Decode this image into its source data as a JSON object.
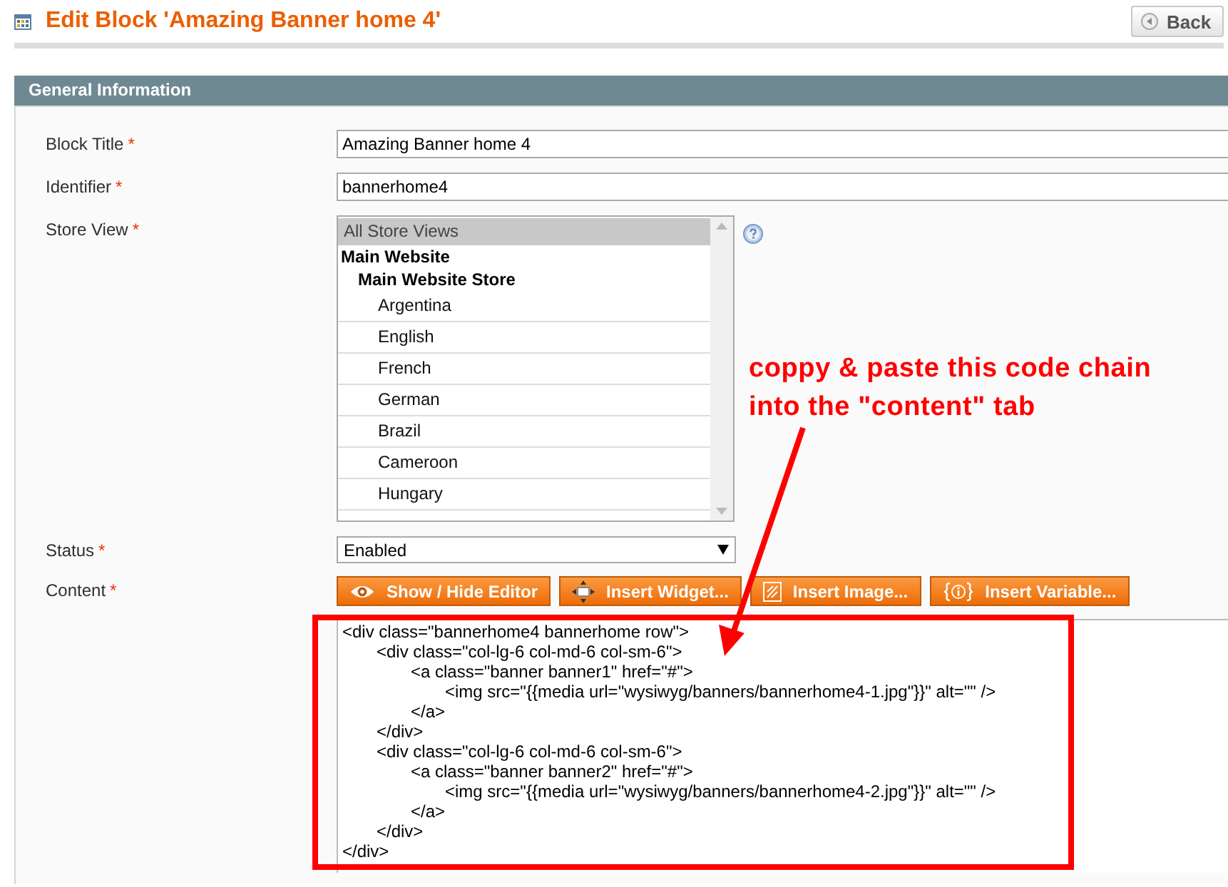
{
  "header": {
    "title": "Edit Block 'Amazing Banner home 4'",
    "back_button": "Back"
  },
  "panel": {
    "title": "General Information",
    "fields": [
      {
        "kind": "text",
        "label": "Block Title",
        "required_mark": "*",
        "value": "Amazing Banner home 4"
      },
      {
        "kind": "text",
        "label": "Identifier",
        "required_mark": "*",
        "value": "bannerhome4"
      },
      {
        "kind": "multiselect",
        "label": "Store View",
        "required_mark": "*",
        "options": [
          {
            "label": "All Store Views",
            "selected": true
          },
          {
            "label": "Main Website",
            "children": [
              {
                "label": "Main Website Store",
                "children": [
                  {
                    "label": "Argentina",
                    "selected": false
                  },
                  {
                    "label": "English",
                    "selected": false
                  },
                  {
                    "label": "French",
                    "selected": false
                  },
                  {
                    "label": "German",
                    "selected": false
                  },
                  {
                    "label": "Brazil",
                    "selected": false
                  },
                  {
                    "label": "Cameroon",
                    "selected": false
                  },
                  {
                    "label": "Hungary",
                    "selected": false
                  }
                ]
              }
            ]
          }
        ]
      },
      {
        "kind": "select",
        "label": "Status",
        "required_mark": "*",
        "value": "Enabled"
      },
      {
        "kind": "editor",
        "label": "Content",
        "required_mark": "*",
        "buttons": [
          {
            "kind": "toggle",
            "label": "Show / Hide Editor"
          },
          {
            "kind": "widget",
            "label": "Insert Widget..."
          },
          {
            "kind": "image",
            "label": "Insert Image..."
          },
          {
            "kind": "variable",
            "label": "Insert Variable..."
          }
        ],
        "value": "<div class=\"bannerhome4 bannerhome row\">\n\t<div class=\"col-lg-6 col-md-6 col-sm-6\">\n\t\t<a class=\"banner banner1\" href=\"#\">\n\t\t\t<img src=\"{{media url=\"wysiwyg/banners/bannerhome4-1.jpg\"}}\" alt=\"\" />\n\t\t</a>\n\t</div>\n\t<div class=\"col-lg-6 col-md-6 col-sm-6\">\n\t\t<a class=\"banner banner2\" href=\"#\">\n\t\t\t<img src=\"{{media url=\"wysiwyg/banners/bannerhome4-2.jpg\"}}\" alt=\"\" />\n\t\t</a>\n\t</div>\n</div>"
      }
    ]
  },
  "annotation": {
    "note": "coppy & paste this code chain\ninto the \"content\" tab"
  }
}
